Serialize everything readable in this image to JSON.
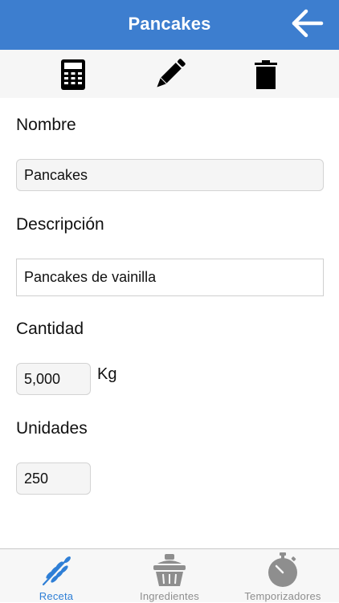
{
  "header": {
    "title": "Pancakes",
    "back_icon": "arrow-left-icon"
  },
  "toolbar": {
    "items": [
      {
        "icon": "calculator-icon"
      },
      {
        "icon": "pencil-icon"
      },
      {
        "icon": "trash-icon"
      }
    ]
  },
  "form": {
    "nombre_label": "Nombre",
    "nombre_value": "Pancakes",
    "descripcion_label": "Descripción",
    "descripcion_value": "Pancakes de vainilla",
    "cantidad_label": "Cantidad",
    "cantidad_value": "5,000",
    "cantidad_unit": "Kg",
    "unidades_label": "Unidades",
    "unidades_value": "250"
  },
  "tabbar": {
    "tabs": [
      {
        "label": "Receta",
        "icon": "wheat-icon",
        "active": true
      },
      {
        "label": "Ingredientes",
        "icon": "basket-icon",
        "active": false
      },
      {
        "label": "Temporizadores",
        "icon": "stopwatch-icon",
        "active": false
      }
    ]
  },
  "colors": {
    "header_bg": "#3d7ecf",
    "active_tab": "#2f7fd6",
    "inactive_tab": "#8e8e8e"
  }
}
